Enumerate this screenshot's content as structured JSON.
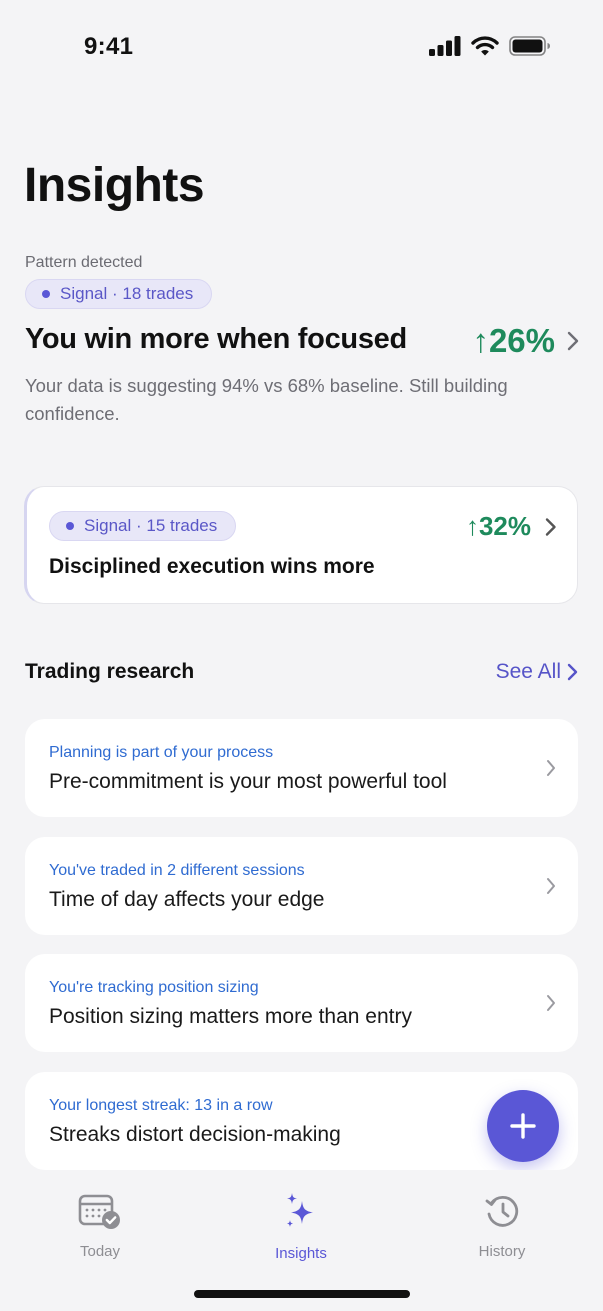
{
  "status_bar": {
    "time": "9:41"
  },
  "page": {
    "title": "Insights"
  },
  "hero": {
    "label": "Pattern detected",
    "pill_text": "Signal · 18 trades",
    "title": "You win more when focused",
    "delta": "↑26%",
    "description": "Your data is suggesting 94% vs 68% baseline. Still building confidence."
  },
  "signal_card": {
    "pill_text": "Signal · 15 trades",
    "title": "Disciplined execution wins more",
    "delta": "↑32%"
  },
  "research": {
    "title": "Trading research",
    "see_all": "See All",
    "items": [
      {
        "subtitle": "Planning is part of your process",
        "headline": "Pre-commitment is your most powerful tool"
      },
      {
        "subtitle": "You've traded in 2 different sessions",
        "headline": "Time of day affects your edge"
      },
      {
        "subtitle": "You're tracking position sizing",
        "headline": "Position sizing matters more than entry"
      },
      {
        "subtitle": "Your longest streak: 13 in a row",
        "headline": "Streaks distort decision-making"
      }
    ]
  },
  "tabs": [
    {
      "label": "Today",
      "icon": "calendar-check-icon"
    },
    {
      "label": "Insights",
      "icon": "sparkles-icon",
      "active": true
    },
    {
      "label": "History",
      "icon": "history-icon"
    }
  ],
  "colors": {
    "accent": "#5a57d6",
    "positive": "#1e8a5c",
    "link": "#2f6bd1",
    "background": "#f4f4f6"
  }
}
